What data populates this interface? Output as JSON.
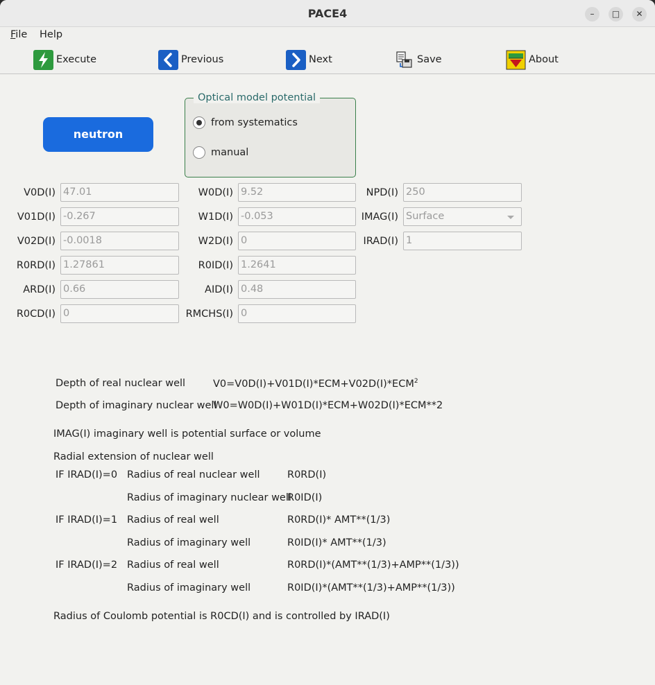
{
  "window": {
    "title": "PACE4"
  },
  "menu": {
    "file": "File",
    "file_rest": "ile",
    "file_accel": "F",
    "help": "Help"
  },
  "toolbar": {
    "execute": "Execute",
    "previous": "Previous",
    "next": "Next",
    "save": "Save",
    "about": "About"
  },
  "particle_button": "neutron",
  "optical_model": {
    "title": "Optical model potential",
    "options": [
      "from systematics",
      "manual"
    ],
    "selected": "from systematics"
  },
  "fields": {
    "v0d": {
      "label": "V0D(I)",
      "value": "47.01"
    },
    "v01d": {
      "label": "V01D(I)",
      "value": "-0.267"
    },
    "v02d": {
      "label": "V02D(I)",
      "value": "-0.0018"
    },
    "r0rd": {
      "label": "R0RD(I)",
      "value": "1.27861"
    },
    "ard": {
      "label": "ARD(I)",
      "value": "0.66"
    },
    "r0cd": {
      "label": "R0CD(I)",
      "value": "0"
    },
    "w0d": {
      "label": "W0D(I)",
      "value": "9.52"
    },
    "w1d": {
      "label": "W1D(I)",
      "value": "-0.053"
    },
    "w2d": {
      "label": "W2D(I)",
      "value": "0"
    },
    "r0id": {
      "label": "R0ID(I)",
      "value": "1.2641"
    },
    "aid": {
      "label": "AID(I)",
      "value": "0.48"
    },
    "rmchs": {
      "label": "RMCHS(I)",
      "value": "0"
    },
    "npd": {
      "label": "NPD(I)",
      "value": "250"
    },
    "imag": {
      "label": "IMAG(I)",
      "value": "Surface"
    },
    "irad": {
      "label": "IRAD(I)",
      "value": "1"
    }
  },
  "help": {
    "real_depth_label": "Depth of real nuclear well",
    "real_depth_formula": "V0=V0D(I)+V01D(I)*ECM+V02D(I)*ECM",
    "real_depth_sup": "2",
    "imag_depth_label": "Depth of imaginary nuclear well",
    "imag_depth_formula": "W0=W0D(I)+W01D(I)*ECM+W02D(I)*ECM**2",
    "imag_note": "IMAG(I) imaginary well is potential surface or volume",
    "radial_title": "Radial extension of nuclear well",
    "rows": [
      {
        "cond": "IF IRAD(I)=0",
        "desc": "Radius of real nuclear well",
        "expr": "R0RD(I)"
      },
      {
        "cond": "",
        "desc": "Radius of imaginary nuclear well",
        "expr": "R0ID(I)"
      },
      {
        "cond": "IF IRAD(I)=1",
        "desc": "Radius of real well",
        "expr": "R0RD(I)* AMT**(1/3)"
      },
      {
        "cond": "",
        "desc": "Radius of imaginary well",
        "expr": "R0ID(I)* AMT**(1/3)"
      },
      {
        "cond": "IF IRAD(I)=2",
        "desc": "Radius of real well",
        "expr": "R0RD(I)*(AMT**(1/3)+AMP**(1/3))"
      },
      {
        "cond": "",
        "desc": "Radius of imaginary well",
        "expr": "R0ID(I)*(AMT**(1/3)+AMP**(1/3))"
      }
    ],
    "coulomb_note": "Radius of Coulomb potential is R0CD(I) and is controlled by IRAD(I)"
  }
}
